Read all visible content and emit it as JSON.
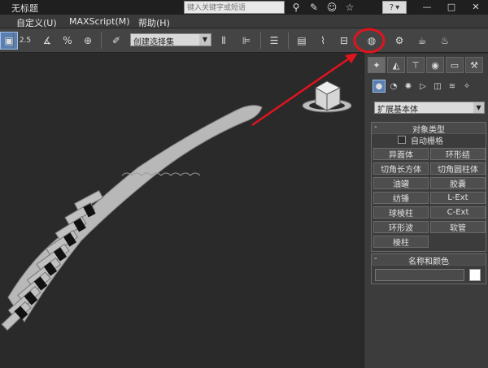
{
  "window": {
    "title": "无标题",
    "search_placeholder": "键入关键字或短语",
    "help_label": "?",
    "controls": {
      "minimize": "—",
      "maximize": "□",
      "close": "✕"
    }
  },
  "menu": {
    "items": [
      "自定义(U)",
      "MAXScript(M)",
      "帮助(H)"
    ]
  },
  "toolbar": {
    "snap_2_5": "2.5",
    "percent_snap": "%",
    "named_selection_set": "创建选择集"
  },
  "command_panel": {
    "category": "扩展基本体",
    "object_type_title": "对象类型",
    "autogrid_label": "自动栅格",
    "object_buttons": [
      "异面体",
      "环形结",
      "切角长方体",
      "切角圆柱体",
      "油罐",
      "胶囊",
      "纺锤",
      "L-Ext",
      "球棱柱",
      "C-Ext",
      "环形波",
      "软管",
      "棱柱"
    ],
    "name_color_title": "名称和颜色",
    "name_value": "",
    "object_color": "#ffffff"
  },
  "colors": {
    "annotation_red": "#e0141e",
    "selection_blue": "#5a7fb0"
  },
  "icons": {
    "highlighted_toolbar_icon": "material-editor-icon"
  }
}
